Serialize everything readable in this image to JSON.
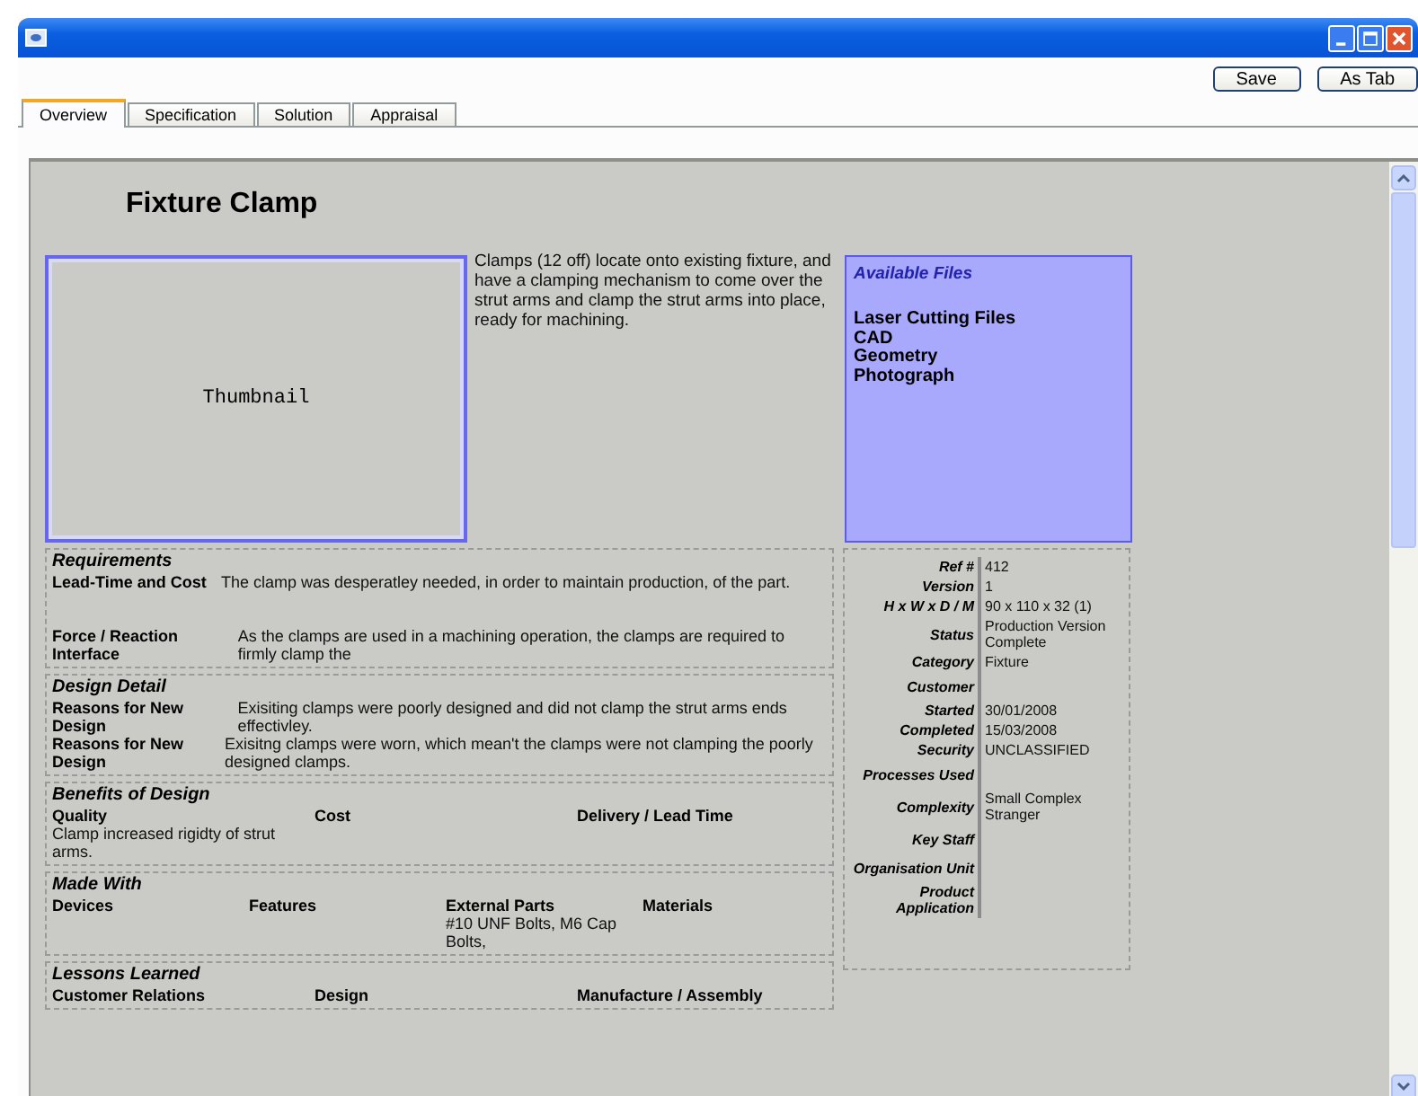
{
  "toolbar": {
    "buttons": [
      "Save",
      "As Tab"
    ]
  },
  "tabs": [
    {
      "label": "Overview",
      "selected": true
    },
    {
      "label": "Specification",
      "selected": false
    },
    {
      "label": "Solution",
      "selected": false
    },
    {
      "label": "Appraisal",
      "selected": false
    }
  ],
  "document": {
    "title": "Fixture Clamp",
    "thumbnail": "Thumbnail",
    "description": "Clamps (12 off) locate onto existing fixture, and have a clamping mechanism to come over the strut arms and clamp the strut arms into place, ready for machining.",
    "available_files": {
      "heading": "Available Files",
      "files": [
        "Laser Cutting Files",
        "CAD",
        "Geometry",
        "Photograph"
      ]
    }
  },
  "sections": [
    {
      "heading": "Requirements",
      "kind": "pairs",
      "items": [
        {
          "label": "Lead-Time and Cost",
          "text": "The clamp was desperatley needed, in order to maintain production, of the part."
        },
        {
          "label": "Force / Reaction Interface",
          "text": "As the clamps are used in a machining operation, the clamps are required to firmly clamp the"
        }
      ]
    },
    {
      "heading": "Design Detail",
      "kind": "pairs",
      "items": [
        {
          "label": "Reasons for New Design",
          "text": "Exisiting clamps were poorly designed and did not clamp the strut arms ends effectivley."
        },
        {
          "label": "Reasons for New Design",
          "text": "Exisitng clamps were worn, which mean't the clamps were not clamping the poorly designed clamps."
        }
      ]
    },
    {
      "heading": "Benefits of Design",
      "kind": "columns",
      "columns": [
        {
          "label": "Quality",
          "text": "Clamp increased rigidty of strut arms."
        },
        {
          "label": "Cost"
        },
        {
          "label": "Delivery / Lead Time"
        }
      ]
    },
    {
      "heading": "Made With",
      "kind": "columns",
      "columns": [
        {
          "label": "Devices"
        },
        {
          "label": "Features"
        },
        {
          "label": "External Parts",
          "text": "#10 UNF Bolts, M6 Cap Bolts,"
        },
        {
          "label": "Materials"
        }
      ]
    },
    {
      "heading": "Lessons Learned",
      "kind": "columns",
      "columns": [
        {
          "label": "Customer Relations"
        },
        {
          "label": "Design"
        },
        {
          "label": "Manufacture / Assembly"
        }
      ]
    }
  ],
  "properties": [
    {
      "label": "Ref #",
      "value": "412"
    },
    {
      "label": "Version",
      "value": "1"
    },
    {
      "label": "H x W x D / M",
      "value": "90 x 110 x 32 (1)"
    },
    {
      "label": "Status",
      "value": "Production Version Complete"
    },
    {
      "label": "Category",
      "value": "Fixture"
    },
    {
      "label": "Customer"
    },
    {
      "label": "Started",
      "value": "30/01/2008"
    },
    {
      "label": "Completed",
      "value": "15/03/2008"
    },
    {
      "label": "Security",
      "value": "UNCLASSIFIED"
    },
    {
      "label": "Processes Used"
    },
    {
      "label": "Complexity",
      "value": "Small Complex Stranger"
    },
    {
      "label": "Key Staff"
    },
    {
      "label": "Organisation Unit"
    },
    {
      "label": "Product Application"
    }
  ]
}
